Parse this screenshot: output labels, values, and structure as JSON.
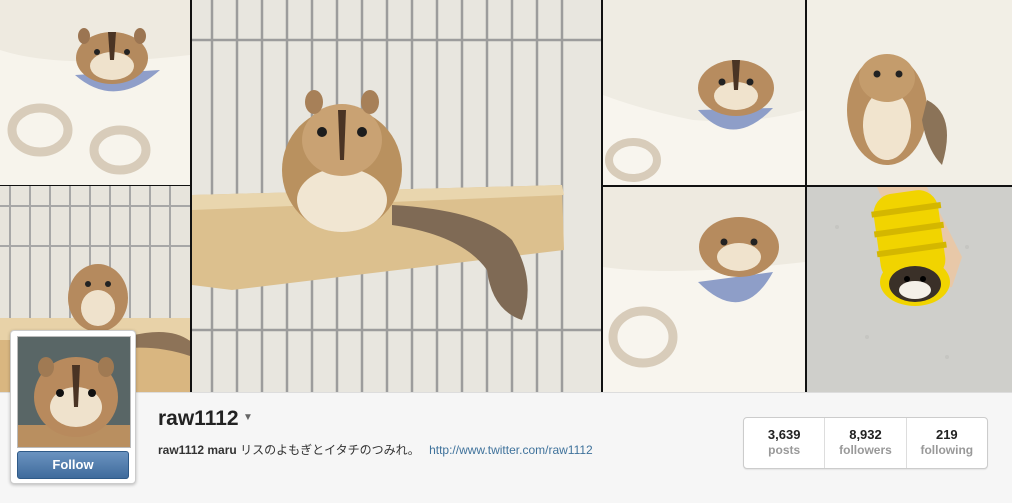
{
  "profile": {
    "username": "raw1112",
    "bio_name": "raw1112 maru",
    "bio_text": "リスのよもぎとイタチのつみれ。",
    "bio_link": "http://www.twitter.com/raw1112",
    "follow_label": "Follow"
  },
  "stats": [
    {
      "value": "3,639",
      "label": "posts"
    },
    {
      "value": "8,932",
      "label": "followers"
    },
    {
      "value": "219",
      "label": "following"
    }
  ],
  "icons": {
    "dropdown": "caret-down-icon"
  },
  "colors": {
    "follow_button": "#3f6b9c",
    "link": "#3f729b",
    "tile_background": "#efece3"
  }
}
